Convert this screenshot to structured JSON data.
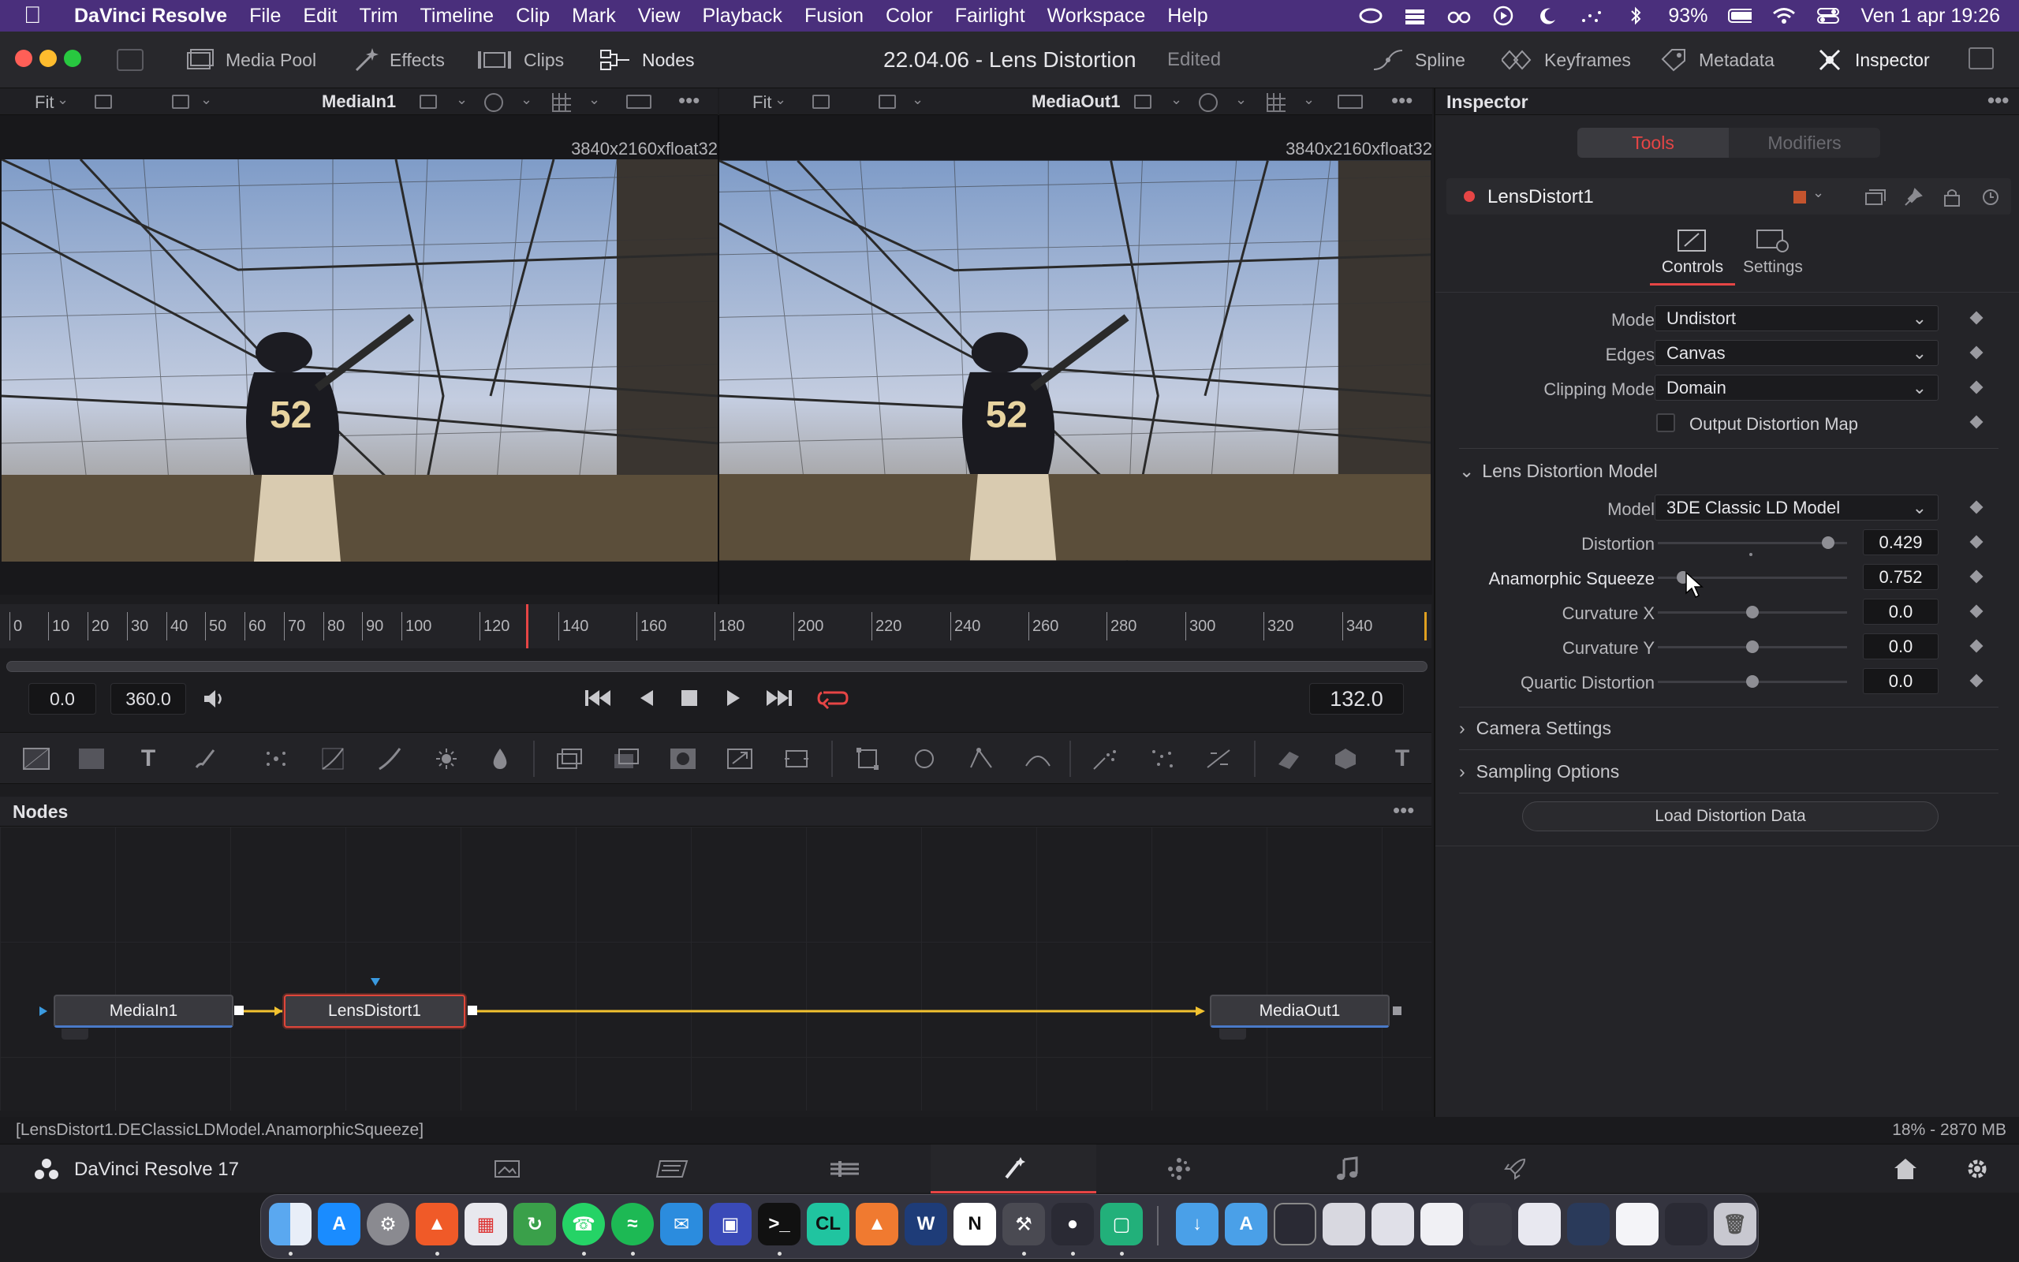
{
  "menubar": {
    "app_name": "DaVinci Resolve",
    "items": [
      "File",
      "Edit",
      "Trim",
      "Timeline",
      "Clip",
      "Mark",
      "View",
      "Playback",
      "Fusion",
      "Color",
      "Fairlight",
      "Workspace",
      "Help"
    ],
    "battery": "93%",
    "clock": "Ven 1 apr  19:26"
  },
  "titlebar": {
    "media_pool": "Media Pool",
    "effects": "Effects",
    "clips": "Clips",
    "nodes": "Nodes",
    "title": "22.04.06 - Lens Distortion",
    "edited": "Edited",
    "spline": "Spline",
    "keyframes": "Keyframes",
    "metadata": "Metadata",
    "inspector": "Inspector"
  },
  "viewers": {
    "left": {
      "fit": "Fit",
      "name": "MediaIn1",
      "resolution": "3840x2160xfloat32"
    },
    "right": {
      "fit": "Fit",
      "name": "MediaOut1",
      "resolution": "3840x2160xfloat32"
    }
  },
  "ruler_ticks": [
    "0",
    "10",
    "20",
    "30",
    "40",
    "50",
    "60",
    "70",
    "80",
    "90",
    "100",
    "120",
    "140",
    "160",
    "180",
    "200",
    "220",
    "240",
    "260",
    "280",
    "300",
    "320",
    "340"
  ],
  "transport": {
    "start": "0.0",
    "end": "360.0",
    "current": "132.0"
  },
  "nodes_panel": {
    "title": "Nodes",
    "nodes": [
      "MediaIn1",
      "LensDistort1",
      "MediaOut1"
    ]
  },
  "inspector": {
    "title": "Inspector",
    "tabs": [
      "Tools",
      "Modifiers"
    ],
    "tool_name": "LensDistort1",
    "subtabs": [
      "Controls",
      "Settings"
    ],
    "mode": {
      "label": "Mode",
      "value": "Undistort"
    },
    "edges": {
      "label": "Edges",
      "value": "Canvas"
    },
    "clipping": {
      "label": "Clipping Mode",
      "value": "Domain"
    },
    "output_map": "Output Distortion Map",
    "section_model": "Lens Distortion Model",
    "model": {
      "label": "Model",
      "value": "3DE Classic LD Model"
    },
    "distortion": {
      "label": "Distortion",
      "value": "0.429"
    },
    "squeeze": {
      "label": "Anamorphic Squeeze",
      "value": "0.752"
    },
    "curvature_x": {
      "label": "Curvature X",
      "value": "0.0"
    },
    "curvature_y": {
      "label": "Curvature Y",
      "value": "0.0"
    },
    "quartic": {
      "label": "Quartic Distortion",
      "value": "0.0"
    },
    "section_camera": "Camera Settings",
    "section_sampling": "Sampling Options",
    "load_button": "Load Distortion Data"
  },
  "statusbar": {
    "path": "[LensDistort1.DEClassicLDModel.AnamorphicSqueeze]",
    "memory": "18% - 2870 MB"
  },
  "pagebar": {
    "app_label": "DaVinci Resolve 17"
  },
  "colors": {
    "menubar": "#4a2f7c",
    "accent_red": "#e64545",
    "connection_yellow": "#f2c230",
    "selected_node_border": "#e0463a"
  }
}
